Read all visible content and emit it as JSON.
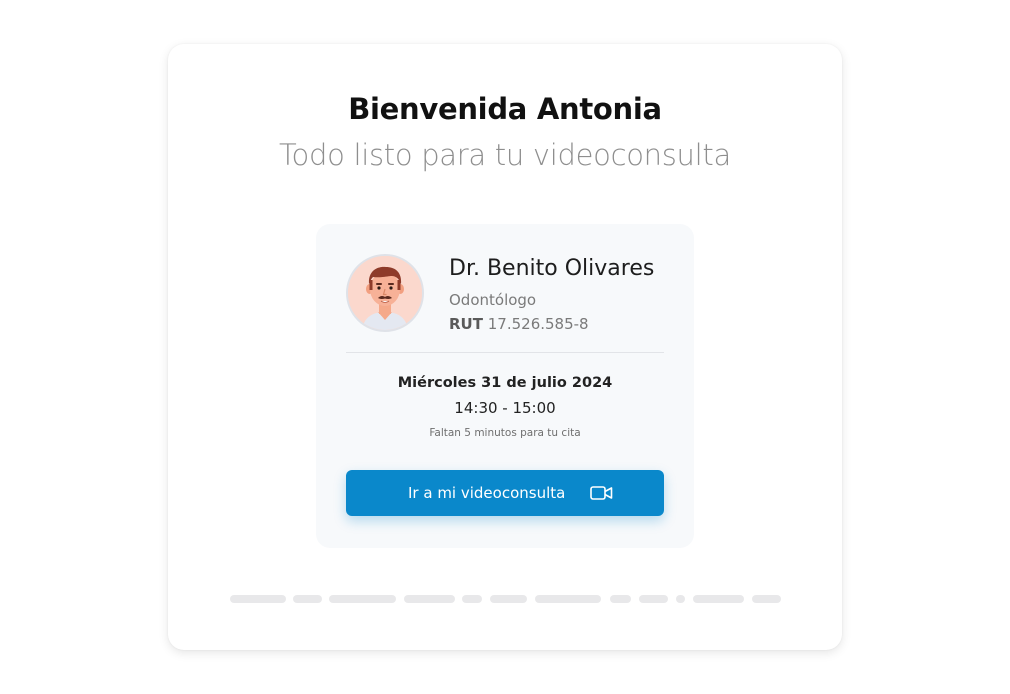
{
  "welcome": {
    "title": "Bienvenida Antonia",
    "subtitle": "Todo listo para tu videoconsulta"
  },
  "doctor": {
    "name": "Dr. Benito Olivares",
    "specialty": "Odontólogo",
    "rut_label": "RUT",
    "rut_value": "17.526.585-8",
    "avatar_icon": "doctor-avatar-icon"
  },
  "appointment": {
    "date": "Miércoles 31 de julio 2024",
    "time": "14:30 - 15:00",
    "countdown": "Faltan 5 minutos para tu cita"
  },
  "join_button": {
    "label": "Ir a mi videoconsulta",
    "icon": "video-camera-icon"
  },
  "colors": {
    "accent": "#0a88cb",
    "card_background": "#f7f9fb",
    "subtitle_gray": "#8e8e8e",
    "avatar_background": "#fbd8cd"
  }
}
